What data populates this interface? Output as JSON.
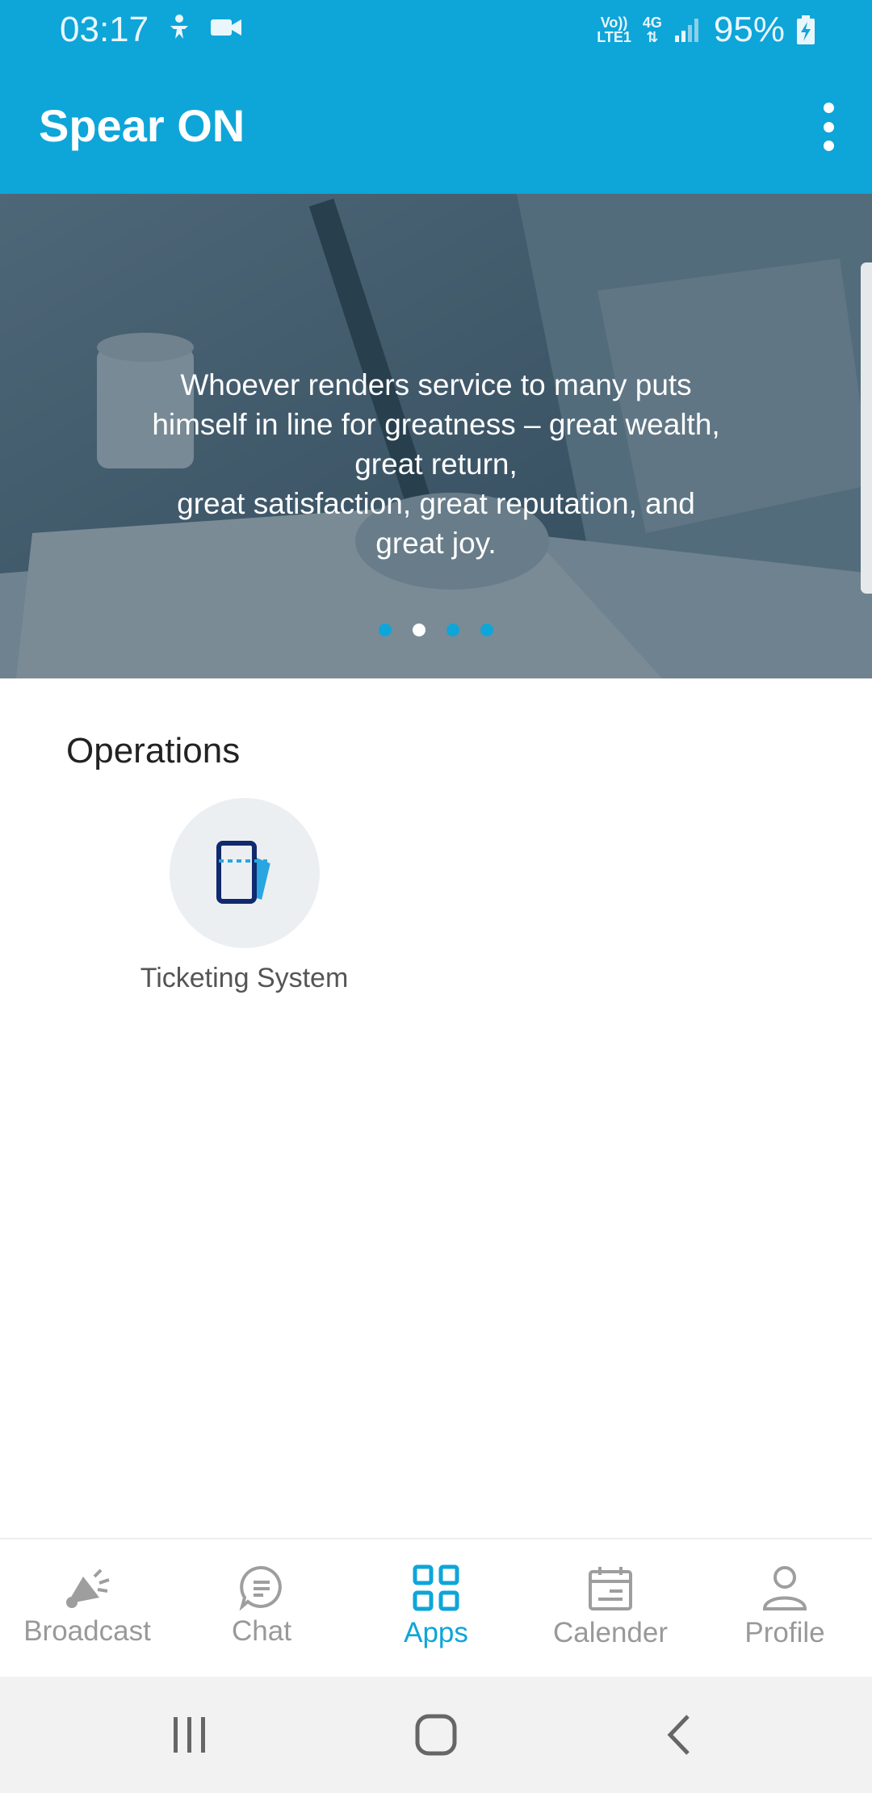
{
  "status_bar": {
    "time": "03:17",
    "network_top": "Vo))",
    "network_bottom": "LTE1",
    "network_type": "4G",
    "battery": "95%"
  },
  "app_bar": {
    "title": "Spear ON",
    "menu_icon": "more-vert-icon"
  },
  "banner": {
    "quote_lines": [
      "Whoever renders service to many puts",
      "himself in line for greatness – great wealth,",
      "great return,",
      "great satisfaction, great reputation, and",
      "great joy."
    ],
    "page_count": 4,
    "active_page": 2
  },
  "operations": {
    "title": "Operations",
    "apps": [
      {
        "label": "Ticketing System",
        "icon": "ticket-icon"
      }
    ]
  },
  "bottom_nav": {
    "items": [
      {
        "label": "Broadcast",
        "icon": "megaphone-icon",
        "active": false
      },
      {
        "label": "Chat",
        "icon": "chat-icon",
        "active": false
      },
      {
        "label": "Apps",
        "icon": "apps-grid-icon",
        "active": true
      },
      {
        "label": "Calender",
        "icon": "calendar-icon",
        "active": false
      },
      {
        "label": "Profile",
        "icon": "profile-icon",
        "active": false
      }
    ]
  },
  "colors": {
    "primary": "#0ea5d9",
    "inactive": "#999999",
    "nav_bar": "#f2f2f2"
  }
}
